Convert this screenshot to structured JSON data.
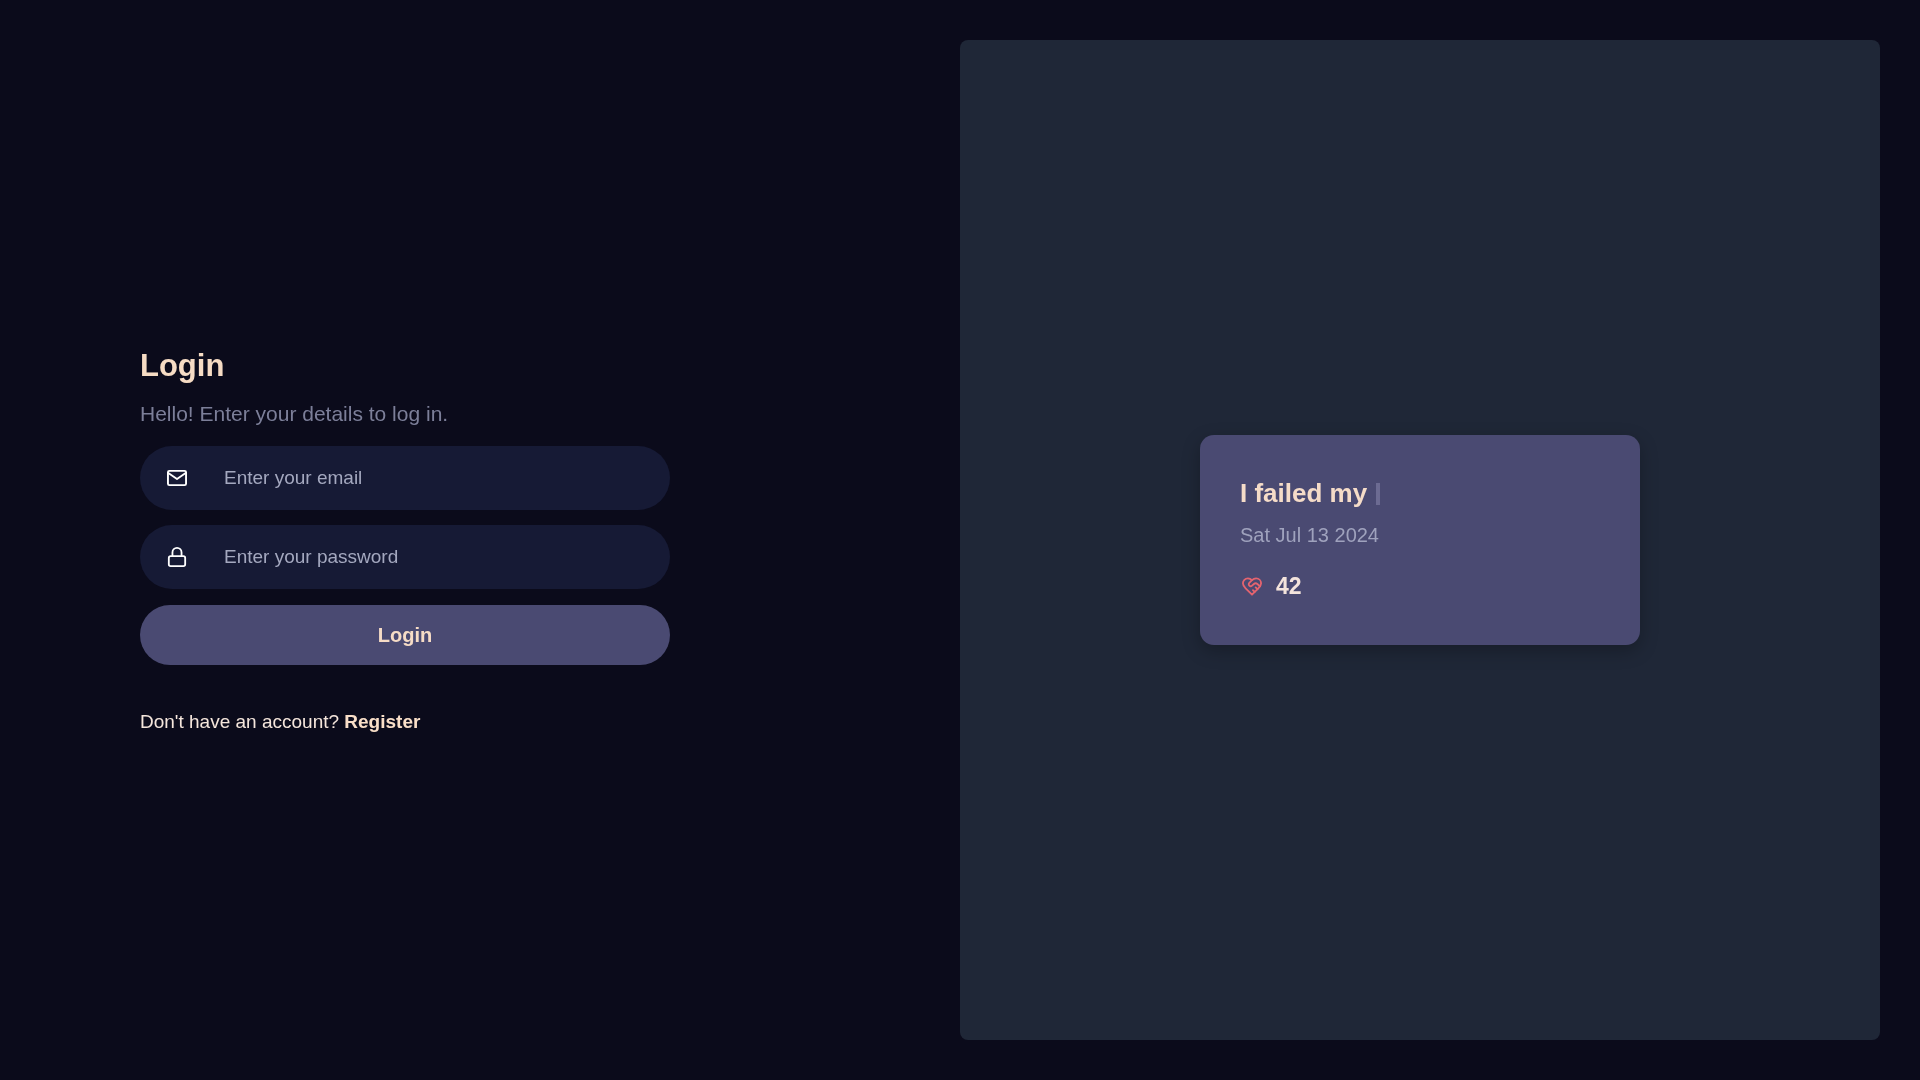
{
  "login": {
    "title": "Login",
    "subtitle": "Hello! Enter your details to log in.",
    "fields": [
      {
        "kind": "email",
        "placeholder": "Enter your email"
      },
      {
        "kind": "password",
        "placeholder": "Enter your password"
      }
    ],
    "button": "Login",
    "register_prompt": "Don't have an account?",
    "register_link": "Register"
  },
  "preview": {
    "card": {
      "title": "I failed my",
      "cursor": true,
      "date": "Sat Jul 13 2024",
      "likes": "42"
    }
  }
}
